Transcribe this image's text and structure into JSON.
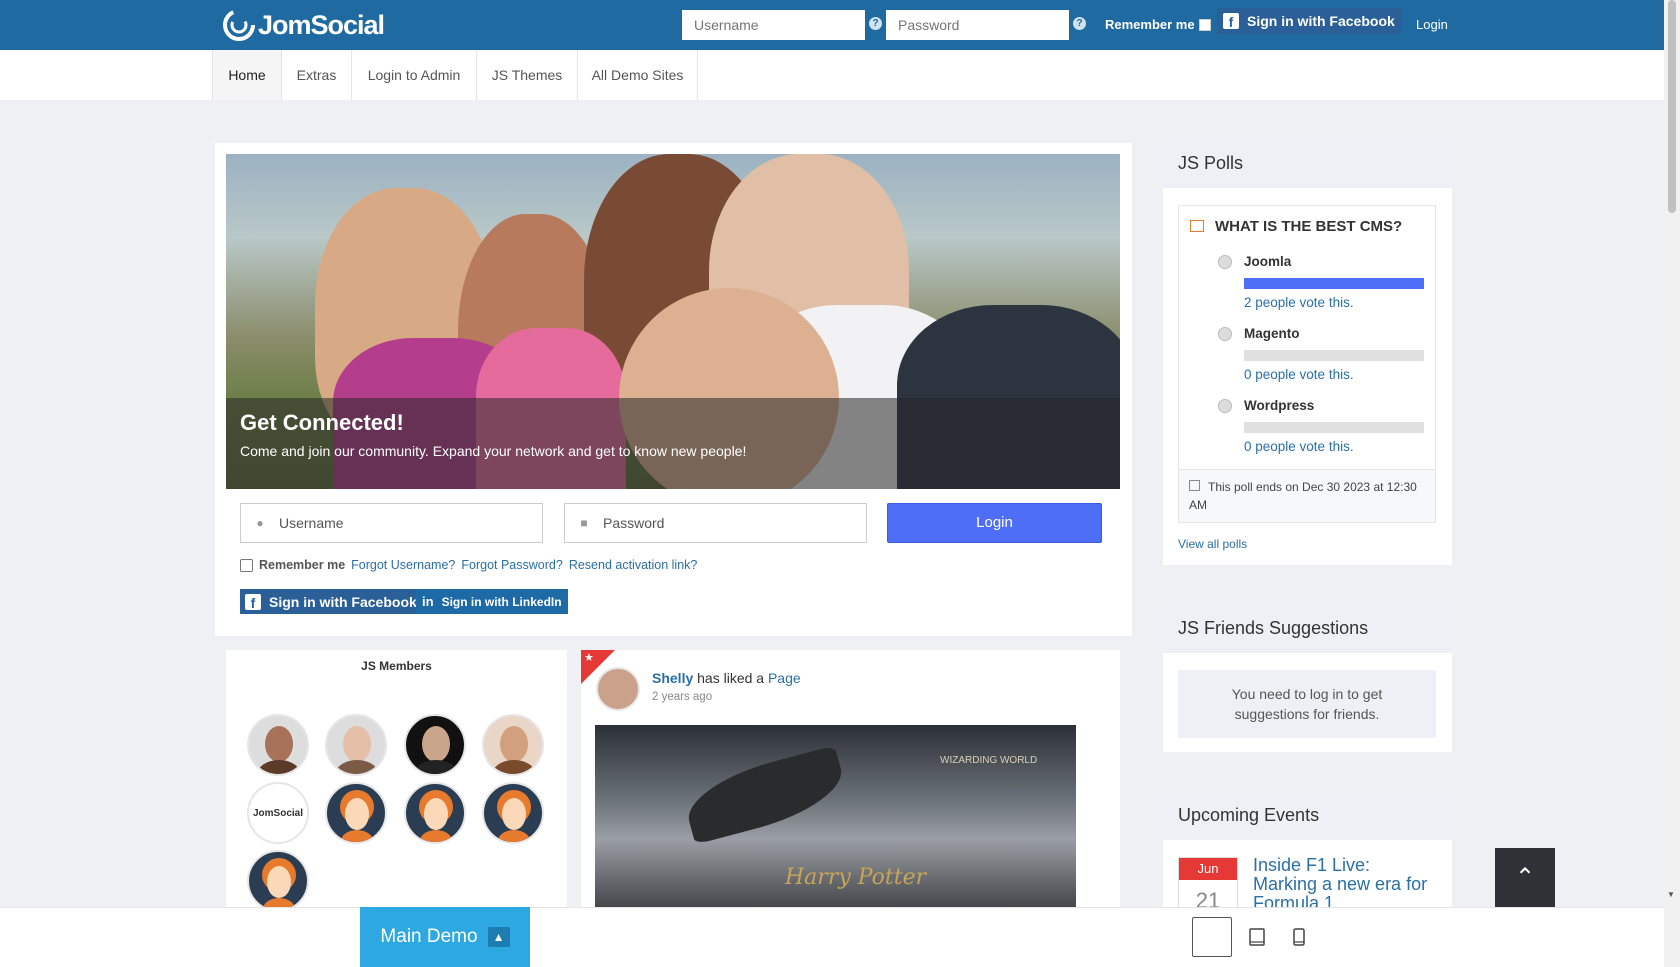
{
  "header": {
    "logo_text": "JomSocial",
    "username_placeholder": "Username",
    "password_placeholder": "Password",
    "remember_label": "Remember me",
    "facebook_label": "Sign in with Facebook",
    "login_label": "Login"
  },
  "nav": {
    "items": [
      {
        "label": "Home"
      },
      {
        "label": "Extras"
      },
      {
        "label": "Login to Admin"
      },
      {
        "label": "JS Themes"
      },
      {
        "label": "All Demo Sites"
      }
    ]
  },
  "hero": {
    "title": "Get Connected!",
    "subtitle": "Come and join our community. Expand your network and get to know new people!"
  },
  "login_form": {
    "username_placeholder": "Username",
    "password_placeholder": "Password",
    "login_button": "Login",
    "remember_label": "Remember me",
    "forgot_username": "Forgot Username?",
    "forgot_password": "Forgot Password?",
    "resend_activation": "Resend activation link?",
    "facebook_button": "Sign in with Facebook",
    "linkedin_button": "Sign in with LinkedIn"
  },
  "members": {
    "title": "JS Members",
    "logo_avatar_text": "JomSocial"
  },
  "stream": {
    "user": "Shelly",
    "action": "has liked a",
    "target": "Page",
    "time": "2 years ago",
    "image_caption": "Harry Potter",
    "image_badge": "WIZARDING WORLD"
  },
  "polls": {
    "title": "JS Polls",
    "question": "WHAT IS THE BEST CMS?",
    "options": [
      {
        "label": "Joomla",
        "votes_text": "2 people vote this.",
        "fraction": 1.0
      },
      {
        "label": "Magento",
        "votes_text": "0 people vote this.",
        "fraction": 0
      },
      {
        "label": "Wordpress",
        "votes_text": "0 people vote this.",
        "fraction": 0
      }
    ],
    "ends_text": "This poll ends on Dec 30 2023 at 12:30 AM",
    "view_all": "View all polls",
    "bar_color": "#4f6ef7"
  },
  "friends": {
    "title": "JS Friends Suggestions",
    "message": "You need to log in to get suggestions for friends."
  },
  "events": {
    "title": "Upcoming Events",
    "month": "Jun",
    "day": "21",
    "event_title": "Inside F1 Live: Marking a new era for Formula 1"
  },
  "footer": {
    "main_demo_label": "Main Demo",
    "scroll_top_icon": "chevron-up-icon",
    "devices": [
      "desktop-icon",
      "tablet-icon",
      "mobile-icon"
    ]
  },
  "colors": {
    "header_bg": "#1f6aa0",
    "accent": "#4f6ef7",
    "facebook": "#2a5f98",
    "link": "#2a6fa7",
    "event_month": "#e53935"
  }
}
